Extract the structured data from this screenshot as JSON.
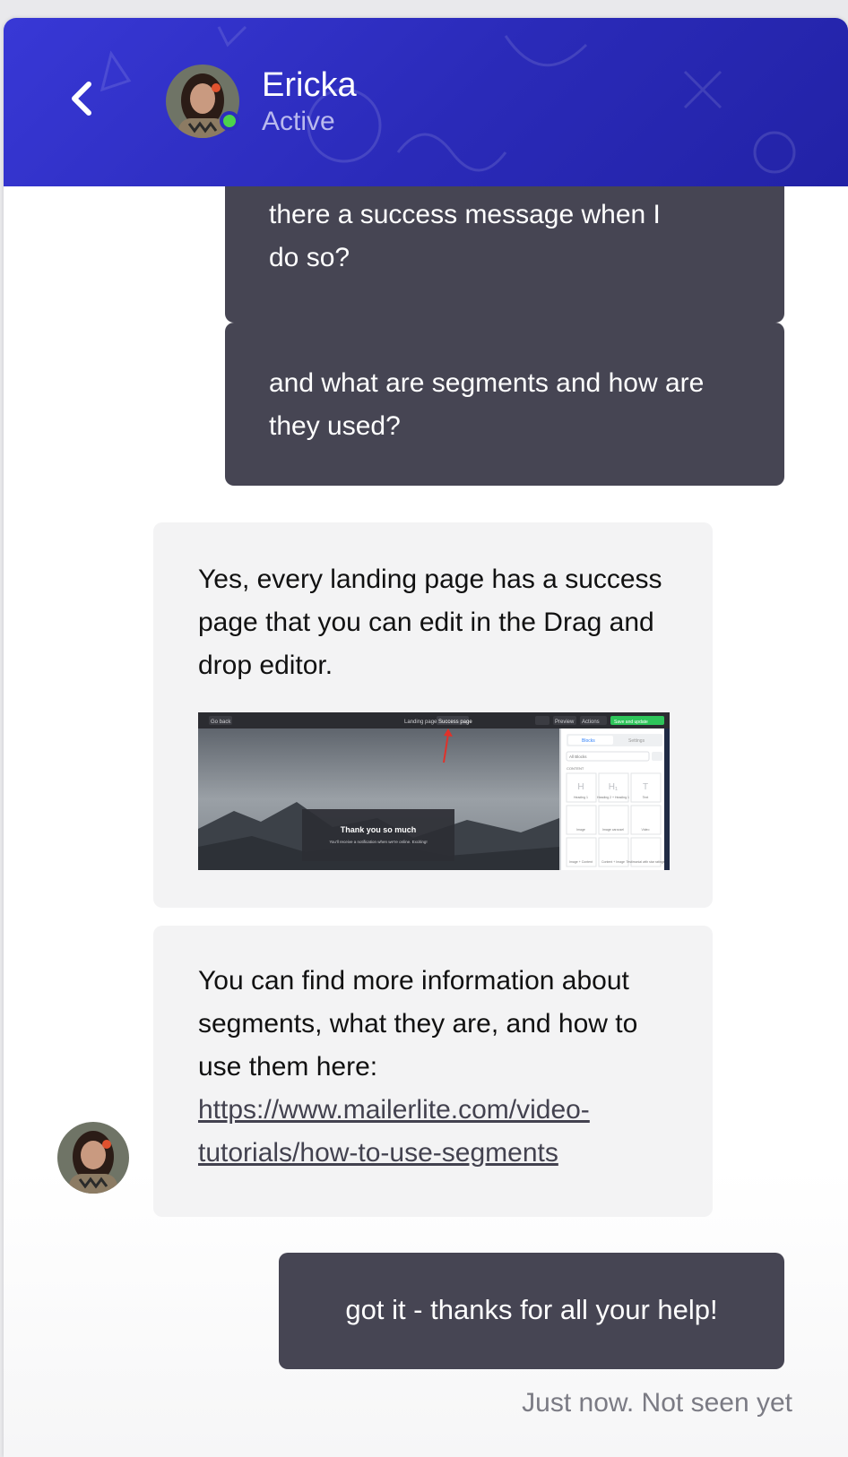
{
  "header": {
    "contact_name": "Ericka",
    "contact_status": "Active"
  },
  "messages": [
    {
      "direction": "outgoing",
      "text_line1": "there a success message when I",
      "text_line2": "do so?"
    },
    {
      "direction": "outgoing",
      "text": "and what are segments and how are they used?"
    },
    {
      "direction": "incoming",
      "text": "Yes, every landing page has a success page that you can edit in the Drag and drop editor."
    },
    {
      "direction": "incoming",
      "text": "You can find more information about segments, what they are, and how to use them here:",
      "link": "https://www.mailerlite.com/video-tutorials/how-to-use-segments"
    },
    {
      "direction": "outgoing",
      "text": "got it - thanks for all your help!"
    }
  ],
  "embedded_screenshot": {
    "top_left_button": "Go back",
    "tab_landing": "Landing page",
    "tab_success": "Success page",
    "preview_button": "Preview",
    "actions_button": "Actions",
    "save_button": "Save and update",
    "panel_tab_blocks": "Blocks",
    "panel_tab_settings": "Settings",
    "filter_label": "All Blocks",
    "content_label": "CONTENT",
    "blocks": [
      "Heading 1",
      "Heading 2 + Heading 1",
      "Text",
      "Image",
      "Image carousel",
      "Video",
      "Image + Content",
      "Content + Image",
      "Testimonial with star ratings"
    ],
    "popup_title": "Thank you so much",
    "popup_subtitle": "You'll receive a notification when we're online. Exciting!"
  },
  "receipt": "Just now. Not seen yet",
  "colors": {
    "header_start": "#3838d6",
    "header_end": "#2222a6",
    "outgoing_bubble": "#464553",
    "incoming_bubble": "#f3f3f4",
    "status_dot": "#4cd24c",
    "save_green": "#2ec55a"
  }
}
